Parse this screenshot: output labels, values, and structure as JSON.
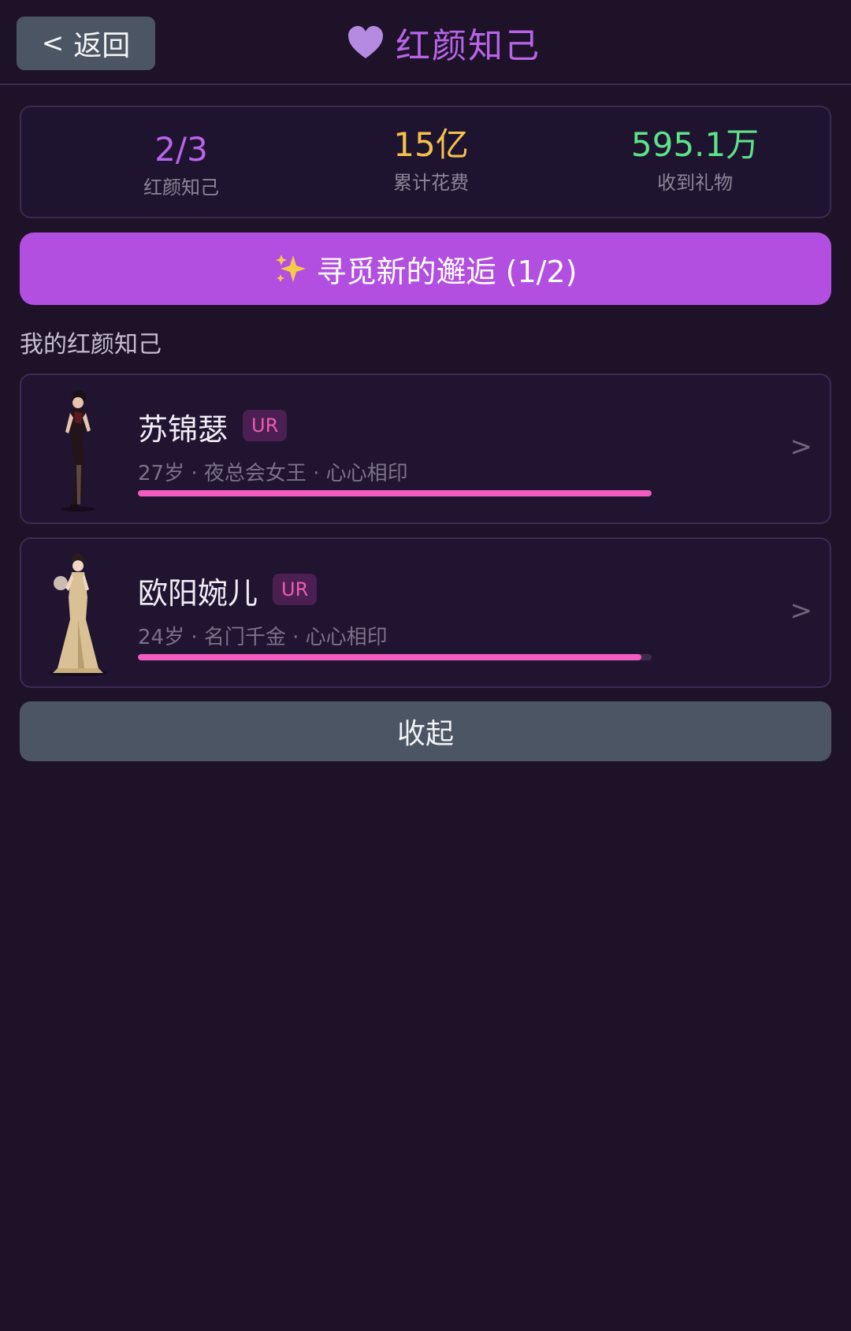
{
  "header": {
    "back_label": "返回",
    "back_chevron": "<",
    "title": "红颜知己",
    "title_icon": "heart-icon"
  },
  "stats": {
    "confidants": {
      "value": "2/3",
      "label": "红颜知己",
      "color": "#b865e8"
    },
    "spent": {
      "value": "15亿",
      "label": "累计花费",
      "color": "#f5c14e"
    },
    "gifts": {
      "value": "595.1万",
      "label": "收到礼物",
      "color": "#5de388"
    }
  },
  "explore": {
    "icon": "sparkle-icon",
    "label": "寻觅新的邂逅 (1/2)",
    "color": "#b24ee0"
  },
  "section": {
    "title": "我的红颜知己"
  },
  "characters": [
    {
      "name": "苏锦瑟",
      "rarity": "UR",
      "meta": "27岁 · 夜总会女王 · 心心相印",
      "affinity": 1.0,
      "chevron": ">"
    },
    {
      "name": "欧阳婉儿",
      "rarity": "UR",
      "meta": "24岁 · 名门千金 · 心心相印",
      "affinity": 0.98,
      "chevron": ">"
    }
  ],
  "collapse": {
    "label": "收起"
  },
  "colors": {
    "background": "#1e1229",
    "accent": "#b865e8",
    "progress": "#f25bc0",
    "button_gray": "#4b5563"
  }
}
